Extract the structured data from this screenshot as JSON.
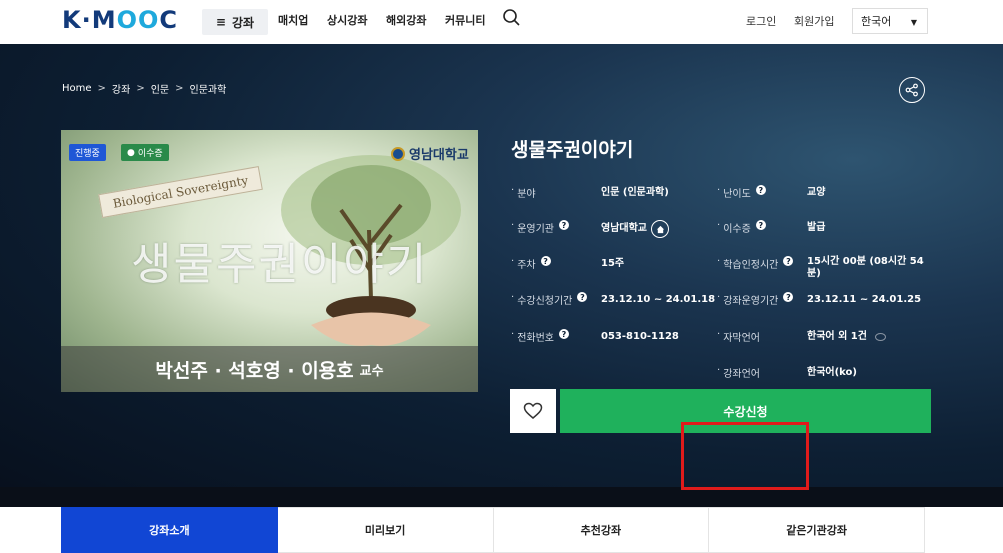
{
  "header": {
    "logo_text_part1": "K·M",
    "logo_text_part2": "OO",
    "logo_text_part3": "C",
    "menu_label": "강좌",
    "nav": [
      "매치업",
      "상시강좌",
      "해외강좌",
      "커뮤니티"
    ],
    "login": "로그인",
    "signup": "회원가입",
    "language": "한국어"
  },
  "breadcrumb": [
    "Home",
    "강좌",
    "인문",
    "인문과학"
  ],
  "breadcrumb_sep": ">",
  "thumbnail": {
    "badge_status": "진행중",
    "badge_cert": "이수증",
    "university": "영남대학교",
    "tag": "Biological Sovereignty",
    "title_art": "생물주권이야기",
    "professors": "박선주 · 석호영 · 이용호",
    "professors_suffix": "교수"
  },
  "course": {
    "title": "생물주권이야기",
    "info": [
      {
        "label": "분야",
        "value": "인문 (인문과학)",
        "help": false
      },
      {
        "label": "난이도",
        "value": "교양",
        "help": true
      },
      {
        "label": "운영기관",
        "value": "영남대학교",
        "help": true,
        "home": true
      },
      {
        "label": "이수증",
        "value": "발급",
        "help": true
      },
      {
        "label": "주차",
        "value": "15주",
        "help": true
      },
      {
        "label": "학습인정시간",
        "value": "15시간 00분 (08시간 54분)",
        "help": true
      },
      {
        "label": "수강신청기간",
        "value": "23.12.10 ~ 24.01.18",
        "help": true
      },
      {
        "label": "강좌운영기간",
        "value": "23.12.11 ~ 24.01.25",
        "help": true
      },
      {
        "label": "전화번호",
        "value": "053-810-1128",
        "help": true
      },
      {
        "label": "자막언어",
        "value": "한국어 외 1건",
        "help": false,
        "bubble": true
      },
      {
        "label": "강좌언어",
        "value": "한국어(ko)",
        "help": false
      }
    ]
  },
  "actions": {
    "enroll": "수강신청"
  },
  "tabs": [
    "강좌소개",
    "미리보기",
    "추천강좌",
    "같은기관강좌"
  ],
  "colors": {
    "accent_green": "#1fb15c",
    "tab_active": "#1146d4",
    "highlight": "#e01b1b"
  }
}
